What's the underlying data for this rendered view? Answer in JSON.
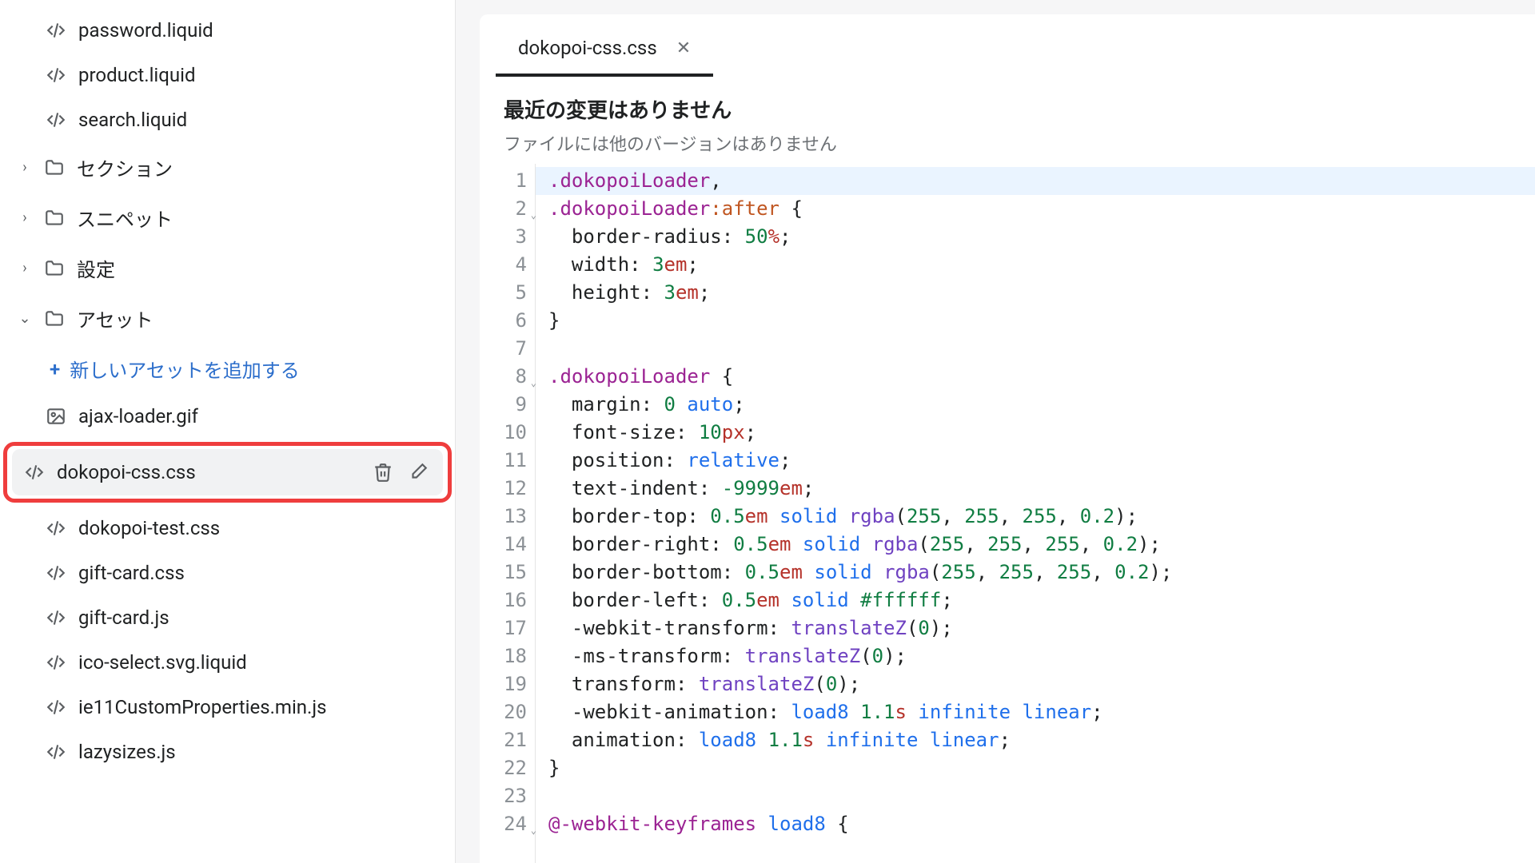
{
  "sidebar": {
    "top_files": [
      {
        "name": "password.liquid"
      },
      {
        "name": "product.liquid"
      },
      {
        "name": "search.liquid"
      }
    ],
    "folders": [
      {
        "name": "セクション",
        "expanded": false
      },
      {
        "name": "スニペット",
        "expanded": false
      },
      {
        "name": "設定",
        "expanded": false
      }
    ],
    "assets_folder_label": "アセット",
    "add_asset_label": "新しいアセットを追加する",
    "asset_files": [
      {
        "name": "ajax-loader.gif",
        "icon": "image"
      },
      {
        "name": "dokopoi-css.css",
        "icon": "code",
        "selected": true
      },
      {
        "name": "dokopoi-test.css",
        "icon": "code"
      },
      {
        "name": "gift-card.css",
        "icon": "code"
      },
      {
        "name": "gift-card.js",
        "icon": "code"
      },
      {
        "name": "ico-select.svg.liquid",
        "icon": "code"
      },
      {
        "name": "ie11CustomProperties.min.js",
        "icon": "code"
      },
      {
        "name": "lazysizes.js",
        "icon": "code"
      }
    ]
  },
  "editor": {
    "tab_label": "dokopoi-css.css",
    "heading": "最近の変更はありません",
    "subheading": "ファイルには他のバージョンはありません",
    "lines": [
      {
        "n": 1,
        "highlight": true,
        "tokens": [
          {
            "t": ".dokopoiLoader",
            "c": "tok-sel"
          },
          {
            "t": ",",
            "c": "tok-punc"
          }
        ]
      },
      {
        "n": 2,
        "fold": true,
        "tokens": [
          {
            "t": ".dokopoiLoader",
            "c": "tok-sel"
          },
          {
            "t": ":after",
            "c": "tok-pseudo"
          },
          {
            "t": " {",
            "c": "tok-punc"
          }
        ]
      },
      {
        "n": 3,
        "tokens": [
          {
            "t": "  border-radius",
            "c": "tok-prop"
          },
          {
            "t": ": ",
            "c": "tok-punc"
          },
          {
            "t": "50",
            "c": "tok-num"
          },
          {
            "t": "%",
            "c": "tok-unit"
          },
          {
            "t": ";",
            "c": "tok-punc"
          }
        ]
      },
      {
        "n": 4,
        "tokens": [
          {
            "t": "  width",
            "c": "tok-prop"
          },
          {
            "t": ": ",
            "c": "tok-punc"
          },
          {
            "t": "3",
            "c": "tok-num"
          },
          {
            "t": "em",
            "c": "tok-unit"
          },
          {
            "t": ";",
            "c": "tok-punc"
          }
        ]
      },
      {
        "n": 5,
        "tokens": [
          {
            "t": "  height",
            "c": "tok-prop"
          },
          {
            "t": ": ",
            "c": "tok-punc"
          },
          {
            "t": "3",
            "c": "tok-num"
          },
          {
            "t": "em",
            "c": "tok-unit"
          },
          {
            "t": ";",
            "c": "tok-punc"
          }
        ]
      },
      {
        "n": 6,
        "tokens": [
          {
            "t": "}",
            "c": "tok-punc"
          }
        ]
      },
      {
        "n": 7,
        "tokens": [
          {
            "t": "",
            "c": ""
          }
        ]
      },
      {
        "n": 8,
        "fold": true,
        "tokens": [
          {
            "t": ".dokopoiLoader",
            "c": "tok-sel"
          },
          {
            "t": " {",
            "c": "tok-punc"
          }
        ]
      },
      {
        "n": 9,
        "tokens": [
          {
            "t": "  margin",
            "c": "tok-prop"
          },
          {
            "t": ": ",
            "c": "tok-punc"
          },
          {
            "t": "0",
            "c": "tok-num"
          },
          {
            "t": " ",
            "c": ""
          },
          {
            "t": "auto",
            "c": "tok-kw"
          },
          {
            "t": ";",
            "c": "tok-punc"
          }
        ]
      },
      {
        "n": 10,
        "tokens": [
          {
            "t": "  font-size",
            "c": "tok-prop"
          },
          {
            "t": ": ",
            "c": "tok-punc"
          },
          {
            "t": "10",
            "c": "tok-num"
          },
          {
            "t": "px",
            "c": "tok-unit"
          },
          {
            "t": ";",
            "c": "tok-punc"
          }
        ]
      },
      {
        "n": 11,
        "tokens": [
          {
            "t": "  position",
            "c": "tok-prop"
          },
          {
            "t": ": ",
            "c": "tok-punc"
          },
          {
            "t": "relative",
            "c": "tok-kw"
          },
          {
            "t": ";",
            "c": "tok-punc"
          }
        ]
      },
      {
        "n": 12,
        "tokens": [
          {
            "t": "  text-indent",
            "c": "tok-prop"
          },
          {
            "t": ": ",
            "c": "tok-punc"
          },
          {
            "t": "-9999",
            "c": "tok-num"
          },
          {
            "t": "em",
            "c": "tok-unit"
          },
          {
            "t": ";",
            "c": "tok-punc"
          }
        ]
      },
      {
        "n": 13,
        "tokens": [
          {
            "t": "  border-top",
            "c": "tok-prop"
          },
          {
            "t": ": ",
            "c": "tok-punc"
          },
          {
            "t": "0.5",
            "c": "tok-num"
          },
          {
            "t": "em",
            "c": "tok-unit"
          },
          {
            "t": " ",
            "c": ""
          },
          {
            "t": "solid",
            "c": "tok-kw"
          },
          {
            "t": " ",
            "c": ""
          },
          {
            "t": "rgba",
            "c": "tok-fn"
          },
          {
            "t": "(",
            "c": "tok-punc"
          },
          {
            "t": "255",
            "c": "tok-num"
          },
          {
            "t": ", ",
            "c": "tok-punc"
          },
          {
            "t": "255",
            "c": "tok-num"
          },
          {
            "t": ", ",
            "c": "tok-punc"
          },
          {
            "t": "255",
            "c": "tok-num"
          },
          {
            "t": ", ",
            "c": "tok-punc"
          },
          {
            "t": "0.2",
            "c": "tok-num"
          },
          {
            "t": ");",
            "c": "tok-punc"
          }
        ]
      },
      {
        "n": 14,
        "tokens": [
          {
            "t": "  border-right",
            "c": "tok-prop"
          },
          {
            "t": ": ",
            "c": "tok-punc"
          },
          {
            "t": "0.5",
            "c": "tok-num"
          },
          {
            "t": "em",
            "c": "tok-unit"
          },
          {
            "t": " ",
            "c": ""
          },
          {
            "t": "solid",
            "c": "tok-kw"
          },
          {
            "t": " ",
            "c": ""
          },
          {
            "t": "rgba",
            "c": "tok-fn"
          },
          {
            "t": "(",
            "c": "tok-punc"
          },
          {
            "t": "255",
            "c": "tok-num"
          },
          {
            "t": ", ",
            "c": "tok-punc"
          },
          {
            "t": "255",
            "c": "tok-num"
          },
          {
            "t": ", ",
            "c": "tok-punc"
          },
          {
            "t": "255",
            "c": "tok-num"
          },
          {
            "t": ", ",
            "c": "tok-punc"
          },
          {
            "t": "0.2",
            "c": "tok-num"
          },
          {
            "t": ");",
            "c": "tok-punc"
          }
        ]
      },
      {
        "n": 15,
        "tokens": [
          {
            "t": "  border-bottom",
            "c": "tok-prop"
          },
          {
            "t": ": ",
            "c": "tok-punc"
          },
          {
            "t": "0.5",
            "c": "tok-num"
          },
          {
            "t": "em",
            "c": "tok-unit"
          },
          {
            "t": " ",
            "c": ""
          },
          {
            "t": "solid",
            "c": "tok-kw"
          },
          {
            "t": " ",
            "c": ""
          },
          {
            "t": "rgba",
            "c": "tok-fn"
          },
          {
            "t": "(",
            "c": "tok-punc"
          },
          {
            "t": "255",
            "c": "tok-num"
          },
          {
            "t": ", ",
            "c": "tok-punc"
          },
          {
            "t": "255",
            "c": "tok-num"
          },
          {
            "t": ", ",
            "c": "tok-punc"
          },
          {
            "t": "255",
            "c": "tok-num"
          },
          {
            "t": ", ",
            "c": "tok-punc"
          },
          {
            "t": "0.2",
            "c": "tok-num"
          },
          {
            "t": ");",
            "c": "tok-punc"
          }
        ]
      },
      {
        "n": 16,
        "tokens": [
          {
            "t": "  border-left",
            "c": "tok-prop"
          },
          {
            "t": ": ",
            "c": "tok-punc"
          },
          {
            "t": "0.5",
            "c": "tok-num"
          },
          {
            "t": "em",
            "c": "tok-unit"
          },
          {
            "t": " ",
            "c": ""
          },
          {
            "t": "solid",
            "c": "tok-kw"
          },
          {
            "t": " ",
            "c": ""
          },
          {
            "t": "#ffffff",
            "c": "tok-hex"
          },
          {
            "t": ";",
            "c": "tok-punc"
          }
        ]
      },
      {
        "n": 17,
        "tokens": [
          {
            "t": "  -webkit-transform",
            "c": "tok-prop"
          },
          {
            "t": ": ",
            "c": "tok-punc"
          },
          {
            "t": "translateZ",
            "c": "tok-fn"
          },
          {
            "t": "(",
            "c": "tok-punc"
          },
          {
            "t": "0",
            "c": "tok-num"
          },
          {
            "t": ");",
            "c": "tok-punc"
          }
        ]
      },
      {
        "n": 18,
        "tokens": [
          {
            "t": "  -ms-transform",
            "c": "tok-prop"
          },
          {
            "t": ": ",
            "c": "tok-punc"
          },
          {
            "t": "translateZ",
            "c": "tok-fn"
          },
          {
            "t": "(",
            "c": "tok-punc"
          },
          {
            "t": "0",
            "c": "tok-num"
          },
          {
            "t": ");",
            "c": "tok-punc"
          }
        ]
      },
      {
        "n": 19,
        "tokens": [
          {
            "t": "  transform",
            "c": "tok-prop"
          },
          {
            "t": ": ",
            "c": "tok-punc"
          },
          {
            "t": "translateZ",
            "c": "tok-fn"
          },
          {
            "t": "(",
            "c": "tok-punc"
          },
          {
            "t": "0",
            "c": "tok-num"
          },
          {
            "t": ");",
            "c": "tok-punc"
          }
        ]
      },
      {
        "n": 20,
        "tokens": [
          {
            "t": "  -webkit-animation",
            "c": "tok-prop"
          },
          {
            "t": ": ",
            "c": "tok-punc"
          },
          {
            "t": "load8",
            "c": "tok-kw"
          },
          {
            "t": " ",
            "c": ""
          },
          {
            "t": "1.1",
            "c": "tok-num"
          },
          {
            "t": "s",
            "c": "tok-unit"
          },
          {
            "t": " ",
            "c": ""
          },
          {
            "t": "infinite",
            "c": "tok-kw"
          },
          {
            "t": " ",
            "c": ""
          },
          {
            "t": "linear",
            "c": "tok-kw"
          },
          {
            "t": ";",
            "c": "tok-punc"
          }
        ]
      },
      {
        "n": 21,
        "tokens": [
          {
            "t": "  animation",
            "c": "tok-prop"
          },
          {
            "t": ": ",
            "c": "tok-punc"
          },
          {
            "t": "load8",
            "c": "tok-kw"
          },
          {
            "t": " ",
            "c": ""
          },
          {
            "t": "1.1",
            "c": "tok-num"
          },
          {
            "t": "s",
            "c": "tok-unit"
          },
          {
            "t": " ",
            "c": ""
          },
          {
            "t": "infinite",
            "c": "tok-kw"
          },
          {
            "t": " ",
            "c": ""
          },
          {
            "t": "linear",
            "c": "tok-kw"
          },
          {
            "t": ";",
            "c": "tok-punc"
          }
        ]
      },
      {
        "n": 22,
        "tokens": [
          {
            "t": "}",
            "c": "tok-punc"
          }
        ]
      },
      {
        "n": 23,
        "tokens": [
          {
            "t": "",
            "c": ""
          }
        ]
      },
      {
        "n": 24,
        "fold": true,
        "tokens": [
          {
            "t": "@",
            "c": "tok-at"
          },
          {
            "t": "-webkit-keyframes",
            "c": "tok-sel"
          },
          {
            "t": " ",
            "c": ""
          },
          {
            "t": "load8",
            "c": "tok-atname"
          },
          {
            "t": " {",
            "c": "tok-punc"
          }
        ]
      }
    ]
  }
}
